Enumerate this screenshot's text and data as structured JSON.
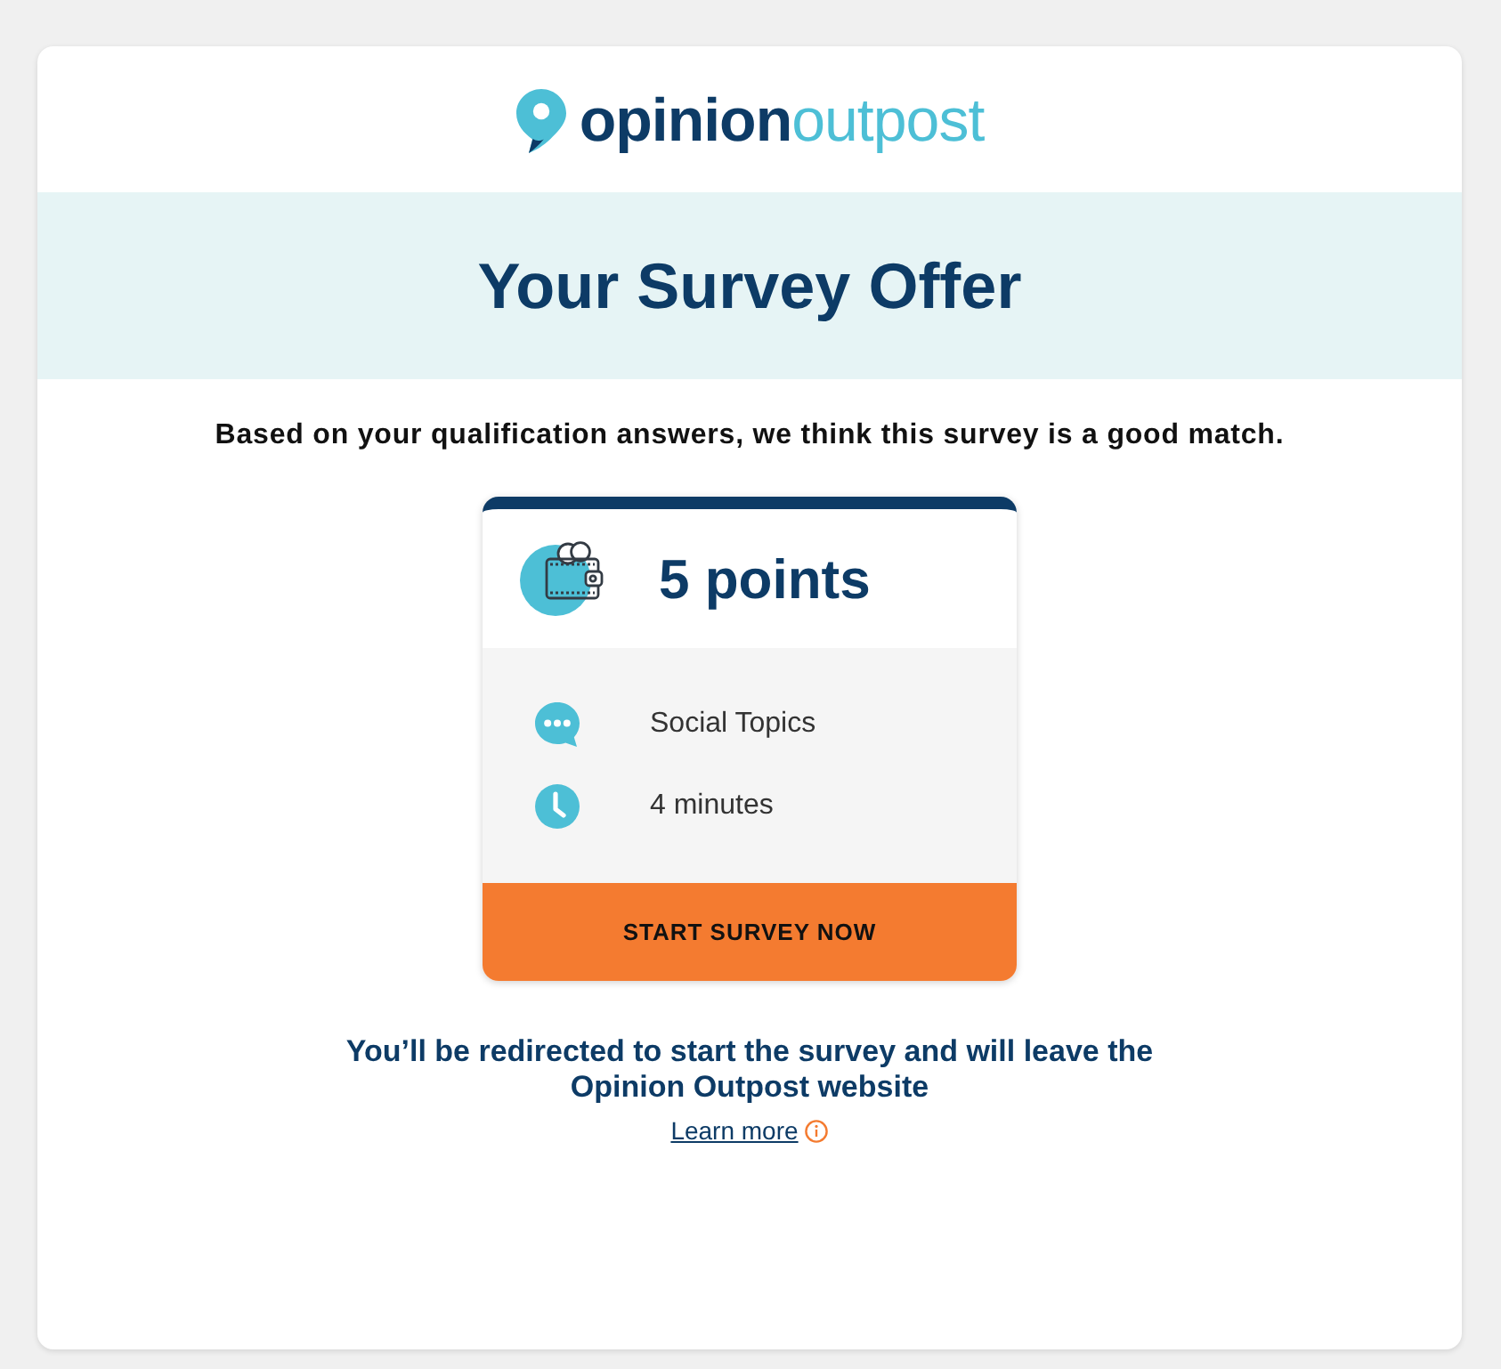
{
  "logo": {
    "bold_part": "opinion",
    "light_part": "outpost"
  },
  "banner": {
    "title": "Your Survey Offer"
  },
  "intro": "Based on your qualification answers, we think this survey is a good match.",
  "offer": {
    "points": "5 points",
    "details": [
      {
        "kind": "topic",
        "text": "Social Topics"
      },
      {
        "kind": "duration",
        "text": "4 minutes"
      }
    ],
    "button": "START SURVEY NOW"
  },
  "notice": "You’ll be redirected to start the survey and will leave the Opinion Outpost website",
  "learn_more": "Learn more"
}
